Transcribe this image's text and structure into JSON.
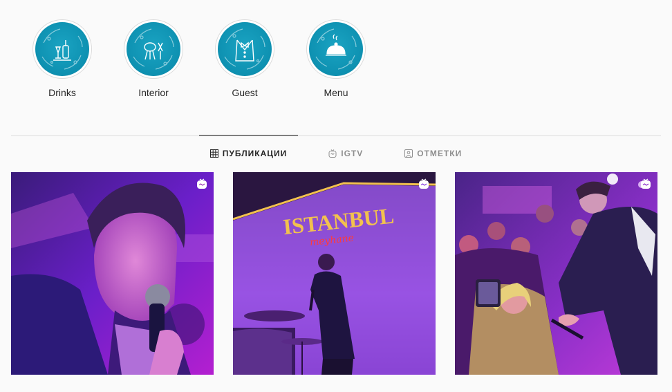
{
  "highlights": [
    {
      "label": "Drinks",
      "icon": "drinks-icon"
    },
    {
      "label": "Interior",
      "icon": "grill-icon"
    },
    {
      "label": "Guest",
      "icon": "tuxedo-icon"
    },
    {
      "label": "Menu",
      "icon": "cloche-icon"
    }
  ],
  "tabs": [
    {
      "label": "ПУБЛИКАЦИИ",
      "icon": "grid-icon",
      "active": true
    },
    {
      "label": "IGTV",
      "icon": "igtv-icon",
      "active": false
    },
    {
      "label": "ОТМЕТКИ",
      "icon": "tagged-icon",
      "active": false
    }
  ],
  "posts": [
    {
      "type": "igtv",
      "scene": "singer-closeup"
    },
    {
      "type": "igtv",
      "scene": "stage-with-sign",
      "sign_text": "ISTANBUL",
      "sign_subtext": "meyhane"
    },
    {
      "type": "igtv",
      "scene": "crowd"
    }
  ],
  "colors": {
    "background": "#fafafa",
    "highlight_teal": "#1aa3c2",
    "stage_purple": "#7b1fd6",
    "stage_magenta": "#d21ad6",
    "sign_gold": "#f2c14e"
  }
}
